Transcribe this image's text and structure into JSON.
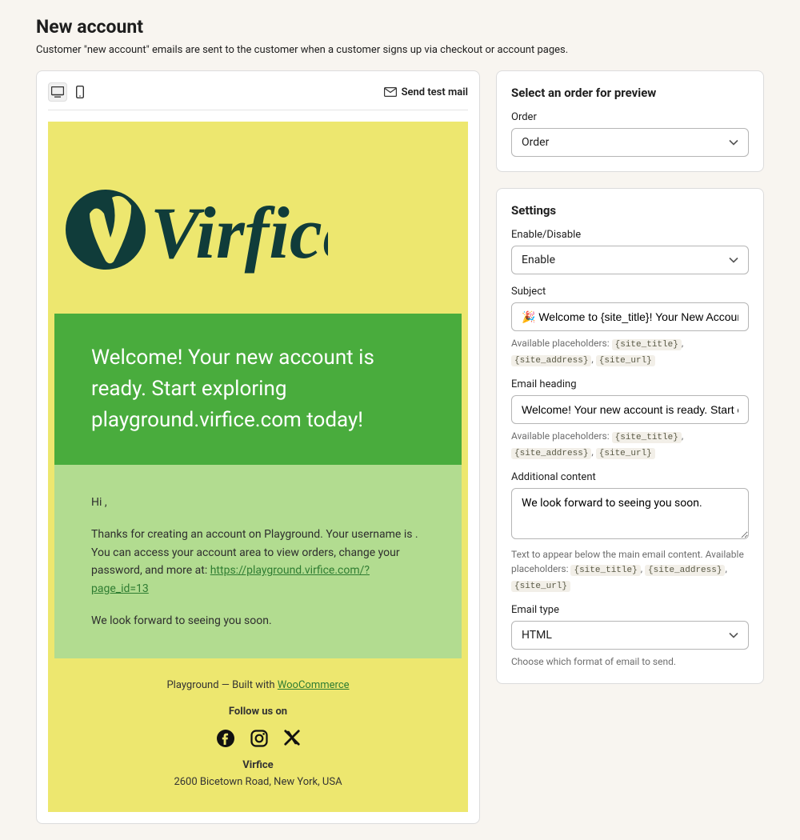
{
  "page": {
    "title": "New account",
    "description": "Customer \"new account\" emails are sent to the customer when a customer signs up via checkout or account pages."
  },
  "preview_toolbar": {
    "send_test_label": "Send test mail"
  },
  "email": {
    "logo_text": "Virfice",
    "heading": "Welcome! Your new account is ready. Start exploring playground.virfice.com today!",
    "greeting": "Hi ,",
    "body_text_1": "Thanks for creating an account on Playground. Your username is . You can access your account area to view orders, change your password, and more at: ",
    "body_link": "https://playground.virfice.com/?page_id=13",
    "body_text_2": "We look forward to seeing you soon.",
    "footer_site": "Playground",
    "footer_built": " — Built with ",
    "footer_built_link": "WooCommerce",
    "follow_label": "Follow us on",
    "company_name": "Virfice",
    "company_address": "2600 Bicetown Road, New York, USA"
  },
  "order_panel": {
    "title": "Select an order for preview",
    "label": "Order",
    "value": "Order"
  },
  "settings": {
    "title": "Settings",
    "enable": {
      "label": "Enable/Disable",
      "value": "Enable"
    },
    "subject": {
      "label": "Subject",
      "value": "🎉 Welcome to {site_title}! Your New Account is",
      "hint_prefix": "Available placeholders: "
    },
    "email_heading": {
      "label": "Email heading",
      "value": "Welcome! Your new account is ready. Start exploring {site_url} today!",
      "hint_prefix": "Available placeholders: "
    },
    "additional_content": {
      "label": "Additional content",
      "value": "We look forward to seeing you soon.",
      "hint": "Text to appear below the main email content. Available placeholders: "
    },
    "email_type": {
      "label": "Email type",
      "value": "HTML",
      "hint": "Choose which format of email to send."
    },
    "placeholders": [
      "{site_title}",
      "{site_address}",
      "{site_url}"
    ]
  }
}
